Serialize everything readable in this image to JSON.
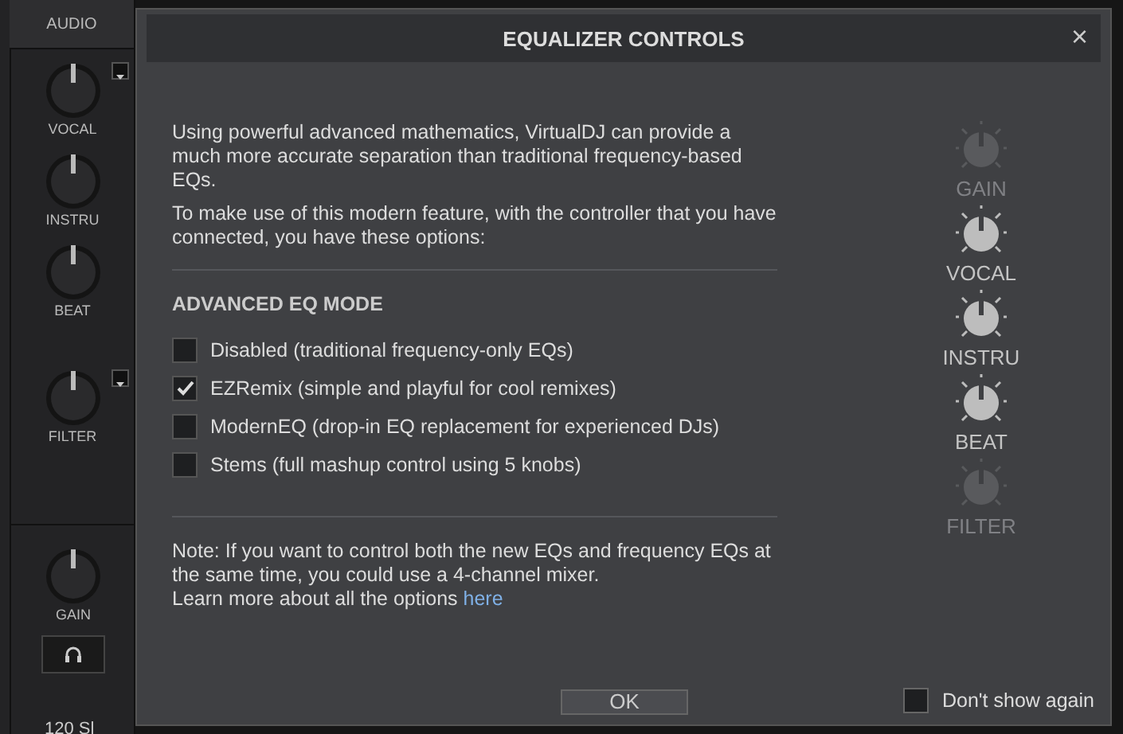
{
  "side_panel": {
    "title": "AUDIO",
    "knobs": [
      {
        "label": "VOCAL",
        "has_menu": true
      },
      {
        "label": "INSTRU",
        "has_menu": false
      },
      {
        "label": "BEAT",
        "has_menu": false
      },
      {
        "label": "FILTER",
        "has_menu": true
      }
    ],
    "gain_label": "GAIN",
    "footer_text": "120 Sl"
  },
  "dialog": {
    "title": "EQUALIZER CONTROLS",
    "close": "×",
    "intro": [
      "Using powerful advanced mathematics, VirtualDJ can provide a much more accurate separation than traditional frequency-based EQs.",
      "To make use of this modern feature, with the controller that you have connected, you have these options:"
    ],
    "section_title": "ADVANCED EQ MODE",
    "options": [
      {
        "label": "Disabled (traditional frequency-only EQs)",
        "checked": false
      },
      {
        "label": "EZRemix (simple and playful for cool remixes)",
        "checked": true
      },
      {
        "label": "ModernEQ (drop-in EQ replacement for experienced DJs)",
        "checked": false
      },
      {
        "label": "Stems (full mashup control using 5 knobs)",
        "checked": false
      }
    ],
    "note": "Note: If you want to control both the new EQs and frequency EQs at the same time, you could use a 4-channel mixer.",
    "learn_more": "Learn more about all the options",
    "link": "here",
    "knobs": [
      {
        "label": "GAIN",
        "enabled": false
      },
      {
        "label": "VOCAL",
        "enabled": true
      },
      {
        "label": "INSTRU",
        "enabled": true
      },
      {
        "label": "BEAT",
        "enabled": true
      },
      {
        "label": "FILTER",
        "enabled": false
      }
    ],
    "ok": "OK",
    "dont_show": {
      "label": "Don't show again",
      "checked": false
    }
  }
}
